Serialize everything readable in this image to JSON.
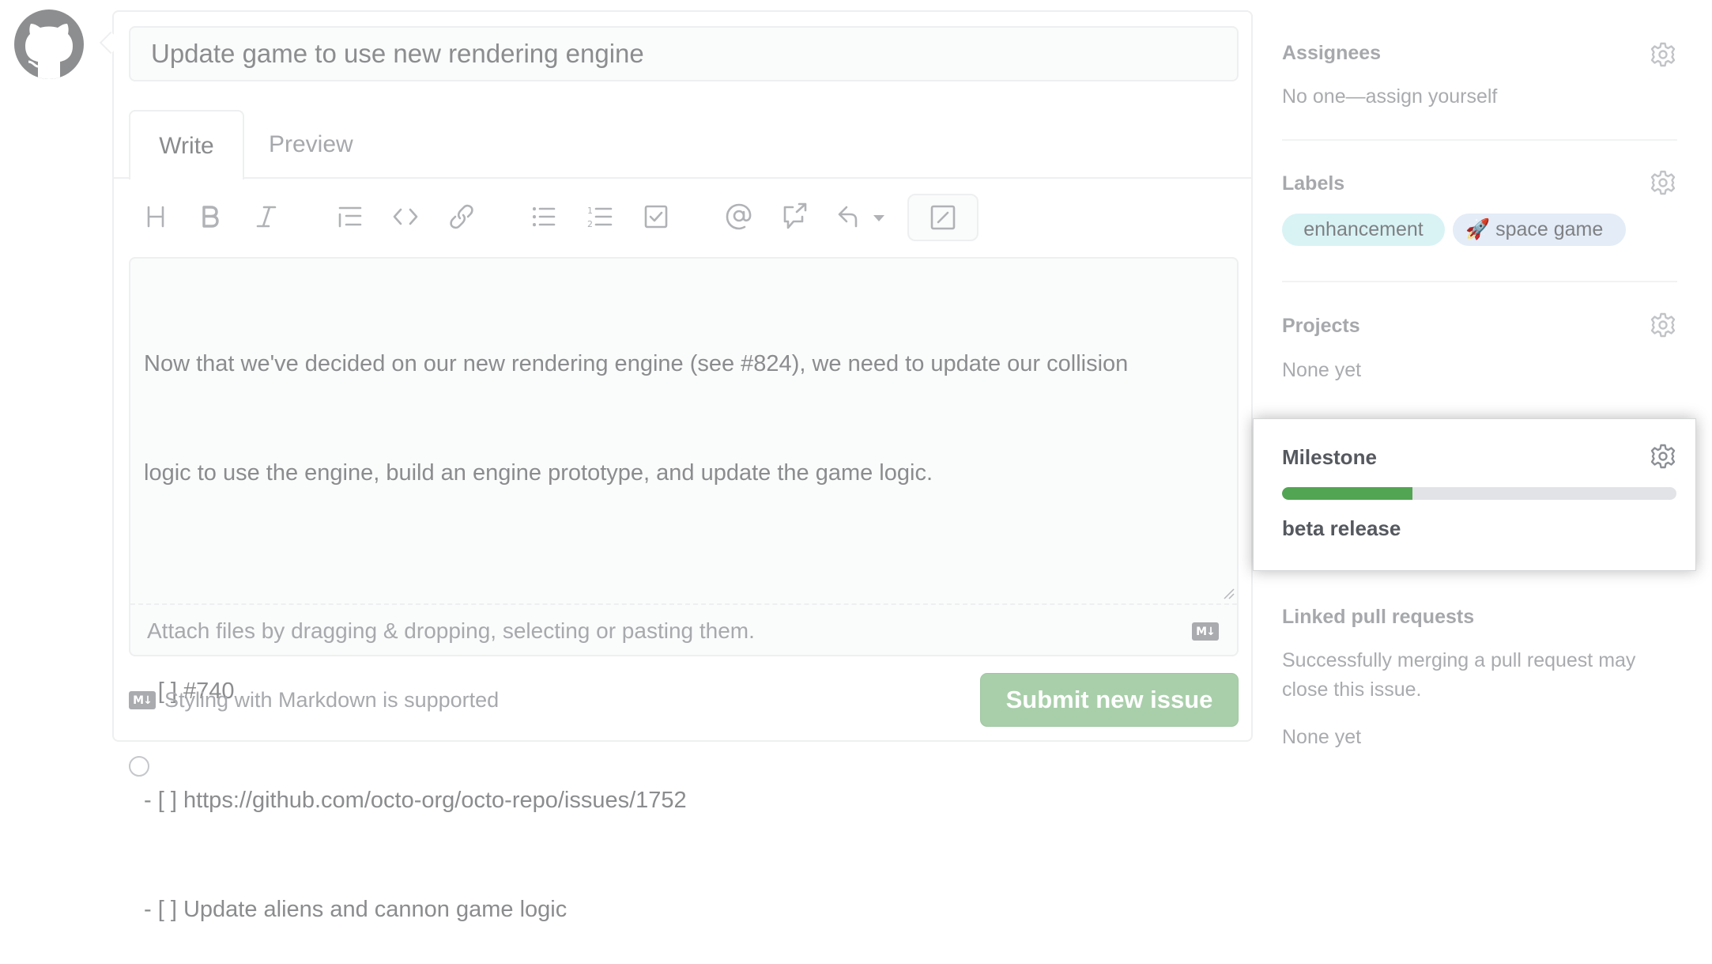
{
  "issue": {
    "title_value": "Update game to use new rendering engine",
    "tabs": [
      {
        "label": "Write",
        "active": true
      },
      {
        "label": "Preview",
        "active": false
      }
    ],
    "toolbar": [
      {
        "icon": "heading-icon"
      },
      {
        "icon": "bold-icon"
      },
      {
        "icon": "italic-icon"
      },
      {
        "icon": "quote-icon"
      },
      {
        "icon": "code-icon"
      },
      {
        "icon": "link-icon"
      },
      {
        "icon": "bulleted-list-icon"
      },
      {
        "icon": "numbered-list-icon"
      },
      {
        "icon": "task-list-icon"
      },
      {
        "icon": "mention-icon"
      },
      {
        "icon": "cross-reference-icon"
      },
      {
        "icon": "saved-replies-icon"
      },
      {
        "icon": "fullscreen-icon"
      }
    ],
    "body_lines": [
      "Now that we've decided on our new rendering engine (see #824), we need to update our collision",
      "logic to use the engine, build an engine prototype, and update the game logic.",
      "",
      "- [ ] #740",
      "- [ ] https://github.com/octo-org/octo-repo/issues/1752",
      "- [ ] Update aliens and cannon game logic"
    ],
    "attach_hint": "Attach files by dragging & dropping, selecting or pasting them.",
    "markdown_badge": "M↓",
    "markdown_note": "Styling with Markdown is supported",
    "submit_label": "Submit new issue"
  },
  "sidebar": {
    "assignees": {
      "heading": "Assignees",
      "value": "No one—assign yourself"
    },
    "labels": {
      "heading": "Labels",
      "items": [
        {
          "name": "enhancement",
          "color": "#d9f3f5"
        },
        {
          "name": "🚀 space game",
          "color": "#e3ecf7"
        }
      ]
    },
    "projects": {
      "heading": "Projects",
      "value": "None yet"
    },
    "milestone": {
      "heading": "Milestone",
      "name": "beta release",
      "progress_percent": 33
    },
    "linked_prs": {
      "heading": "Linked pull requests",
      "description_lines": [
        "Successfully merging a pull request may",
        "close this issue."
      ],
      "value": "None yet"
    }
  },
  "colors": {
    "submit_button": "#a9cfaa",
    "progress_fill": "#52a552",
    "progress_track": "#e2e3e6"
  }
}
